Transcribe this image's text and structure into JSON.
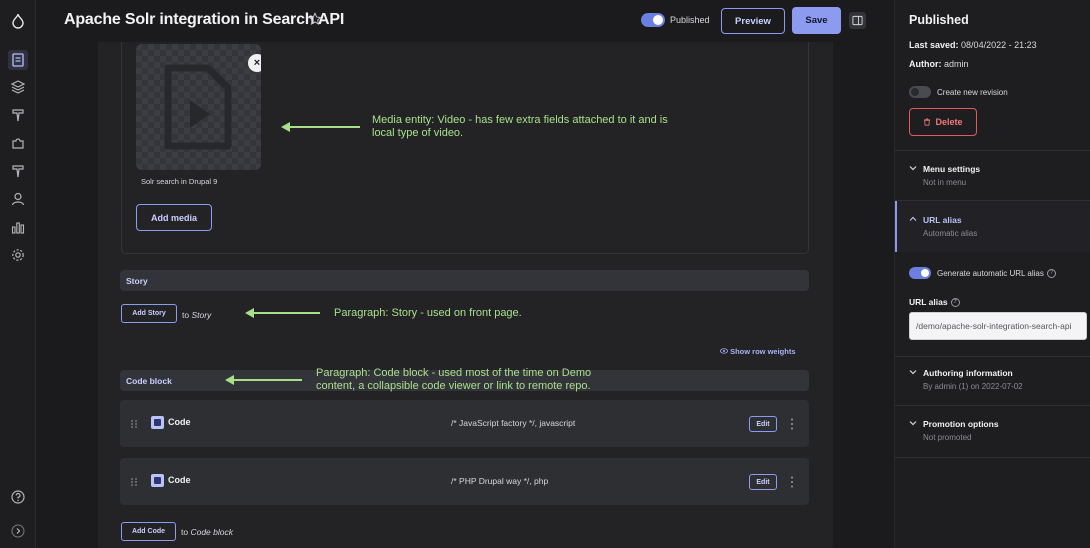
{
  "header": {
    "title": "Apache Solr integration in Search API",
    "published_label": "Published",
    "preview_label": "Preview",
    "save_label": "Save"
  },
  "media": {
    "caption": "Solr search in Drupal 9",
    "close_glyph": "×",
    "add_media_label": "Add media"
  },
  "story": {
    "section_title": "Story",
    "add_button_label": "Add Story",
    "to_prefix": "to",
    "to_target": "Story"
  },
  "row_weights_label": "Show row weights",
  "code_block": {
    "section_title": "Code block",
    "rows": [
      {
        "name": "Code",
        "summary": "/* JavaScript factory */, javascript",
        "edit_label": "Edit"
      },
      {
        "name": "Code",
        "summary": "/* PHP Drupal way */, php",
        "edit_label": "Edit"
      }
    ],
    "add_button_label": "Add Code",
    "to_prefix": "to",
    "to_target": "Code block"
  },
  "annotations": {
    "media_line1": "Media entity: Video - has few extra fields attached to it and is",
    "media_line2": "local type of video.",
    "story": "Paragraph: Story - used on front page.",
    "code_line1": "Paragraph: Code block - used most of the time on Demo",
    "code_line2": "content, a collapsible code viewer or link to remote repo."
  },
  "sidebar": {
    "title": "Published",
    "last_saved_label": "Last saved:",
    "last_saved_value": "08/04/2022 - 21:23",
    "author_label": "Author:",
    "author_value": "admin",
    "revision_label": "Create new revision",
    "delete_label": "Delete",
    "sections": [
      {
        "title": "Menu settings",
        "subtitle": "Not in menu"
      },
      {
        "title": "URL alias",
        "subtitle": "Automatic alias"
      },
      {
        "title": "Authoring information",
        "subtitle": "By admin (1) on 2022-07-02"
      },
      {
        "title": "Promotion options",
        "subtitle": "Not promoted"
      }
    ],
    "generate_alias_label": "Generate automatic URL alias",
    "url_alias_field_label": "URL alias",
    "url_alias_value": "/demo/apache-solr-integration-search-api"
  },
  "colors": {
    "accent": "#8c9bf0",
    "annotation": "#a8e08a",
    "danger": "#e05a5a"
  }
}
